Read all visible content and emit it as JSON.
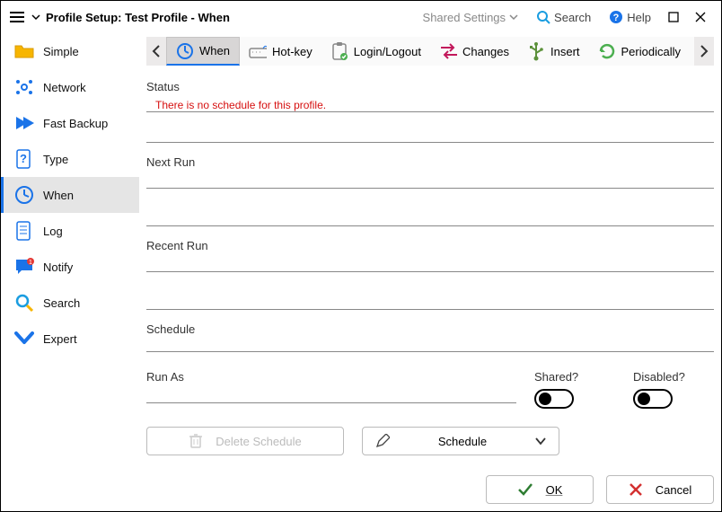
{
  "titlebar": {
    "title": "Profile Setup: Test Profile - When",
    "shared": "Shared Settings",
    "search": "Search",
    "help": "Help"
  },
  "sidebar": {
    "items": [
      {
        "label": "Simple"
      },
      {
        "label": "Network"
      },
      {
        "label": "Fast Backup"
      },
      {
        "label": "Type"
      },
      {
        "label": "When"
      },
      {
        "label": "Log"
      },
      {
        "label": "Notify"
      },
      {
        "label": "Search"
      },
      {
        "label": "Expert"
      }
    ],
    "active_index": 4
  },
  "tabs": {
    "items": [
      {
        "label": "When",
        "icon": "clock",
        "active": true
      },
      {
        "label": "Hot-key",
        "icon": "keyboard"
      },
      {
        "label": "Login/Logout",
        "icon": "clipboard"
      },
      {
        "label": "Changes",
        "icon": "changes"
      },
      {
        "label": "Insert",
        "icon": "usb"
      },
      {
        "label": "Periodically",
        "icon": "refresh"
      }
    ]
  },
  "sections": {
    "status_label": "Status",
    "status_message": "There is no schedule for this profile.",
    "nextrun_label": "Next Run",
    "recentrun_label": "Recent Run",
    "schedule_label": "Schedule",
    "runas_label": "Run As",
    "shared_label": "Shared?",
    "disabled_label": "Disabled?"
  },
  "buttons": {
    "delete_schedule": "Delete Schedule",
    "schedule": "Schedule",
    "ok": "OK",
    "cancel": "Cancel"
  },
  "toggles": {
    "shared": false,
    "disabled": false
  }
}
